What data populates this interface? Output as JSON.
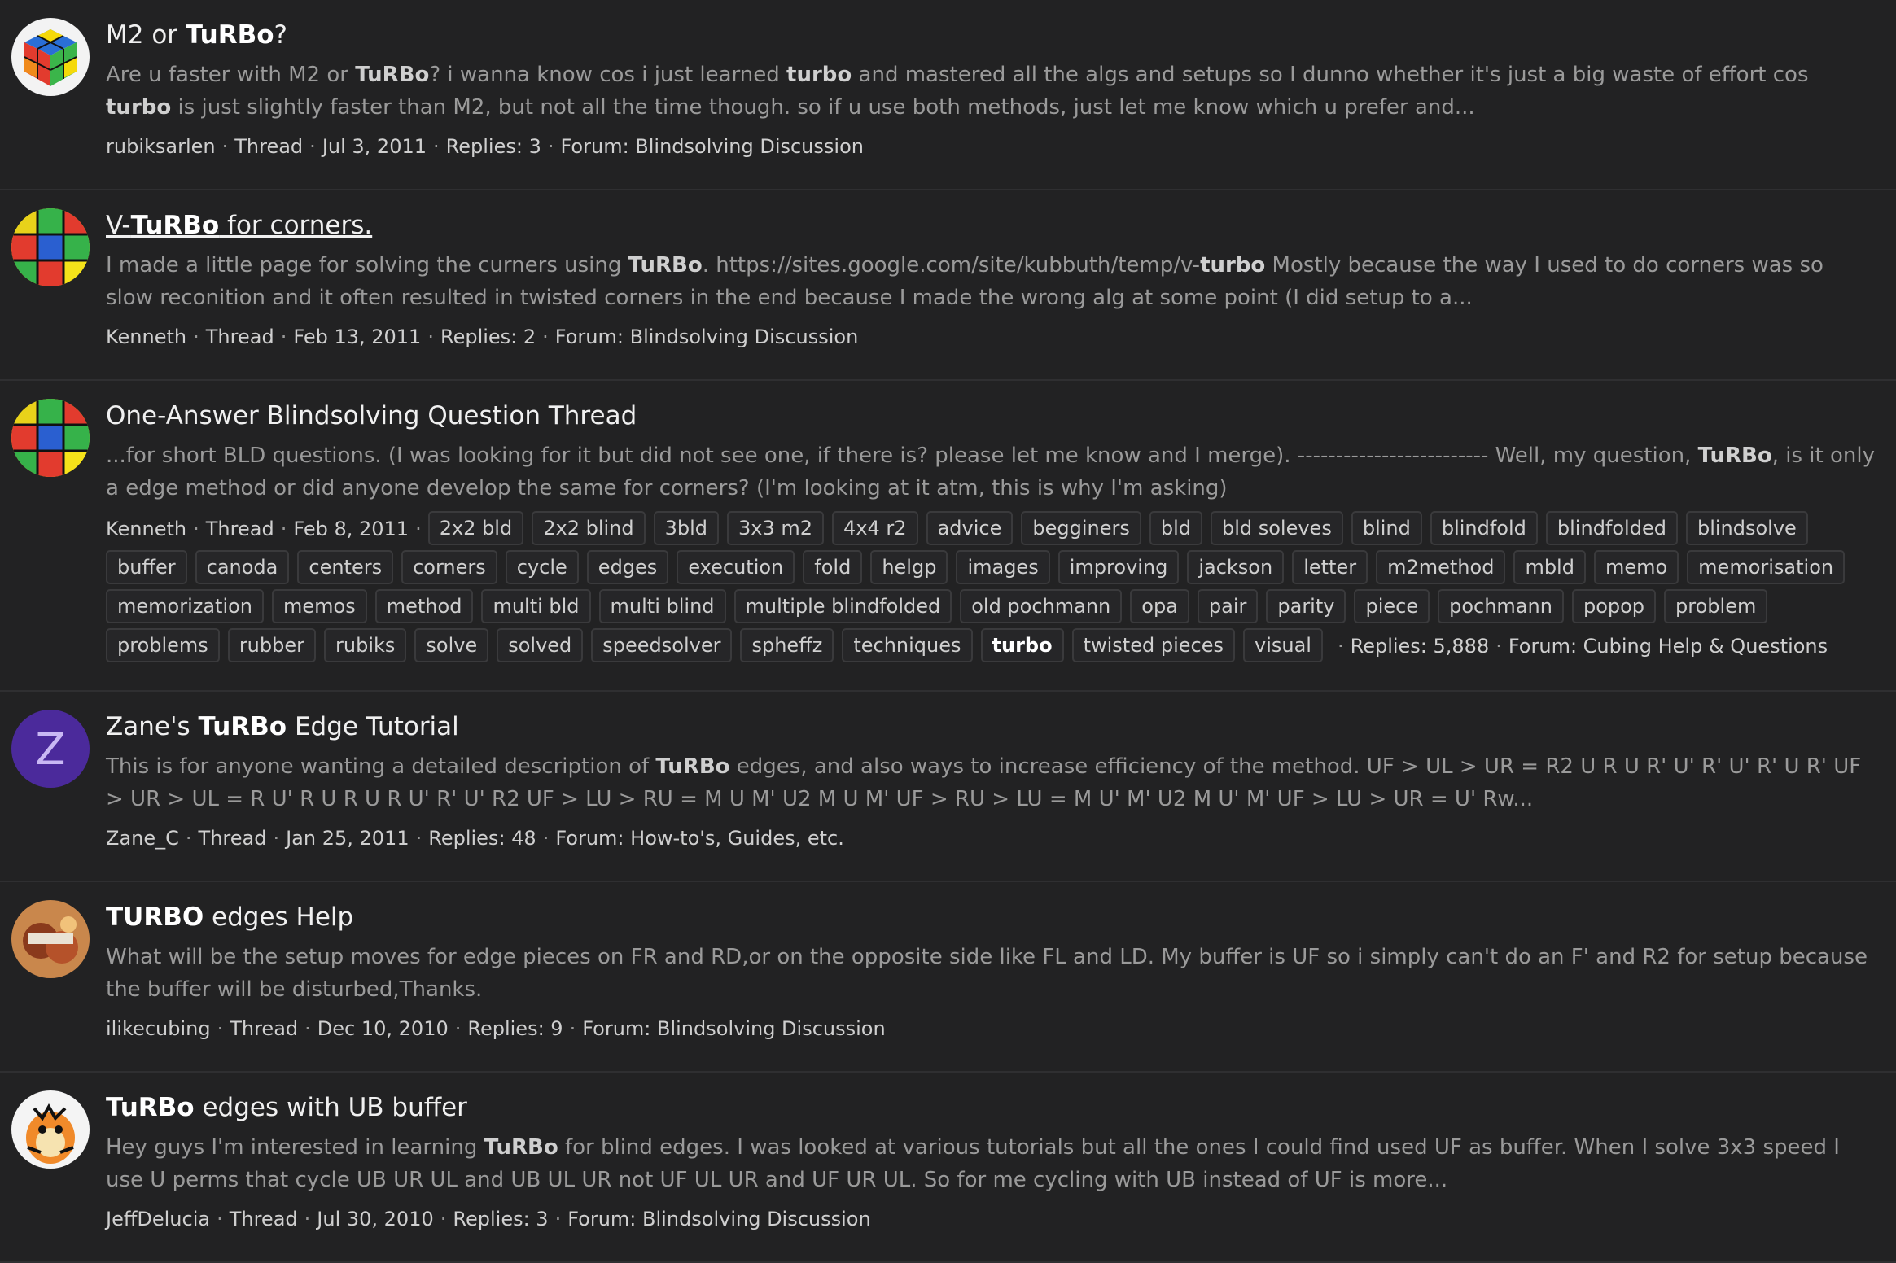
{
  "results": [
    {
      "title_parts": [
        "M2 or ",
        "TuRBo",
        "?"
      ],
      "snippet_parts": [
        "Are u faster with M2 or ",
        "TuRBo",
        "? i wanna know cos i just learned ",
        "turbo",
        " and mastered all the algs and setups so I dunno whether it's just a big waste of effort cos ",
        "turbo",
        " is just slightly faster than M2, but not all the time though. so if u use both methods, just let me know which u prefer and..."
      ],
      "author": "rubiksarlen",
      "type": "Thread",
      "date": "Jul 3, 2011",
      "replies": "Replies: 3",
      "forum": "Forum: Blindsolving Discussion"
    },
    {
      "title_parts": [
        "V-",
        "TuRBo",
        " for corners."
      ],
      "snippet_parts": [
        "I made a little page for solving the curners using ",
        "TuRBo",
        ". https://sites.google.com/site/kubbuth/temp/v-",
        "turbo",
        " Mostly because the way I used to do corners was so slow reconition and it often resulted in twisted corners in the end because I made the wrong alg at some point (I did setup to a..."
      ],
      "author": "Kenneth",
      "type": "Thread",
      "date": "Feb 13, 2011",
      "replies": "Replies: 2",
      "forum": "Forum: Blindsolving Discussion"
    },
    {
      "title_parts": [
        "One-Answer Blindsolving Question Thread"
      ],
      "snippet_parts": [
        "...for short BLD questions. (I was looking for it but did not see one, if there is? please let me know and I merge). ------------------------- Well, my question, ",
        "TuRBo",
        ", is it only a edge method or did anyone develop the same for corners? (I'm looking at it atm, this is why I'm asking)"
      ],
      "author": "Kenneth",
      "type": "Thread",
      "date": "Feb 8, 2011",
      "tags": [
        "2x2 bld",
        "2x2 blind",
        "3bld",
        "3x3 m2",
        "4x4 r2",
        "advice",
        "begginers",
        "bld",
        "bld soleves",
        "blind",
        "blindfold",
        "blindfolded",
        "blindsolve",
        "buffer",
        "canoda",
        "centers",
        "corners",
        "cycle",
        "edges",
        "execution",
        "fold",
        "helgp",
        "images",
        "improving",
        "jackson",
        "letter",
        "m2method",
        "mbld",
        "memo",
        "memorisation",
        "memorization",
        "memos",
        "method",
        "multi bld",
        "multi blind",
        "multiple blindfolded",
        "old pochmann",
        "opa",
        "pair",
        "parity",
        "piece",
        "pochmann",
        "popop",
        "problem",
        "problems",
        "rubber",
        "rubiks",
        "solve",
        "solved",
        "speedsolver",
        "spheffz",
        "techniques",
        "turbo",
        "twisted pieces",
        "visual"
      ],
      "replies": "Replies: 5,888",
      "forum": "Forum: Cubing Help & Questions"
    },
    {
      "title_parts": [
        "Zane's ",
        "TuRBo",
        " Edge Tutorial"
      ],
      "snippet_parts": [
        "This is for anyone wanting a detailed description of ",
        "TuRBo",
        " edges, and also ways to increase efficiency of the method. UF > UL > UR = R2 U R U R' U' R' U' R' U R' UF > UR > UL = R U' R U R U R U' R' U' R2 UF > LU > RU = M U M' U2 M U M' UF > RU > LU = M U' M' U2 M U' M' UF > LU > UR = U' Rw..."
      ],
      "author": "Zane_C",
      "type": "Thread",
      "date": "Jan 25, 2011",
      "replies": "Replies: 48",
      "forum": "Forum: How-to's, Guides, etc.",
      "avatar_letter": "Z"
    },
    {
      "title_parts": [
        "",
        "TURBO",
        " edges Help"
      ],
      "snippet_parts": [
        "What will be the setup moves for edge pieces on FR and RD,or on the opposite side like FL and LD. My buffer is UF so i simply can't do an F' and R2 for setup because the buffer will be disturbed,Thanks."
      ],
      "author": "ilikecubing",
      "type": "Thread",
      "date": "Dec 10, 2010",
      "replies": "Replies: 9",
      "forum": "Forum: Blindsolving Discussion"
    },
    {
      "title_parts": [
        "",
        "TuRBo",
        " edges with UB buffer"
      ],
      "snippet_parts": [
        "Hey guys I'm interested in learning ",
        "TuRBo",
        " for blind edges. I was looked at various tutorials but all the ones I could find used UF as buffer. When I solve 3x3 speed I use U perms that cycle UB UR UL and UB UL UR not UF UL UR and UF UR UL. So for me cycling with UB instead of UF is more..."
      ],
      "author": "JeffDelucia",
      "type": "Thread",
      "date": "Jul 30, 2010",
      "replies": "Replies: 3",
      "forum": "Forum: Blindsolving Discussion"
    }
  ],
  "sep": "·",
  "highlight_tag": "turbo"
}
